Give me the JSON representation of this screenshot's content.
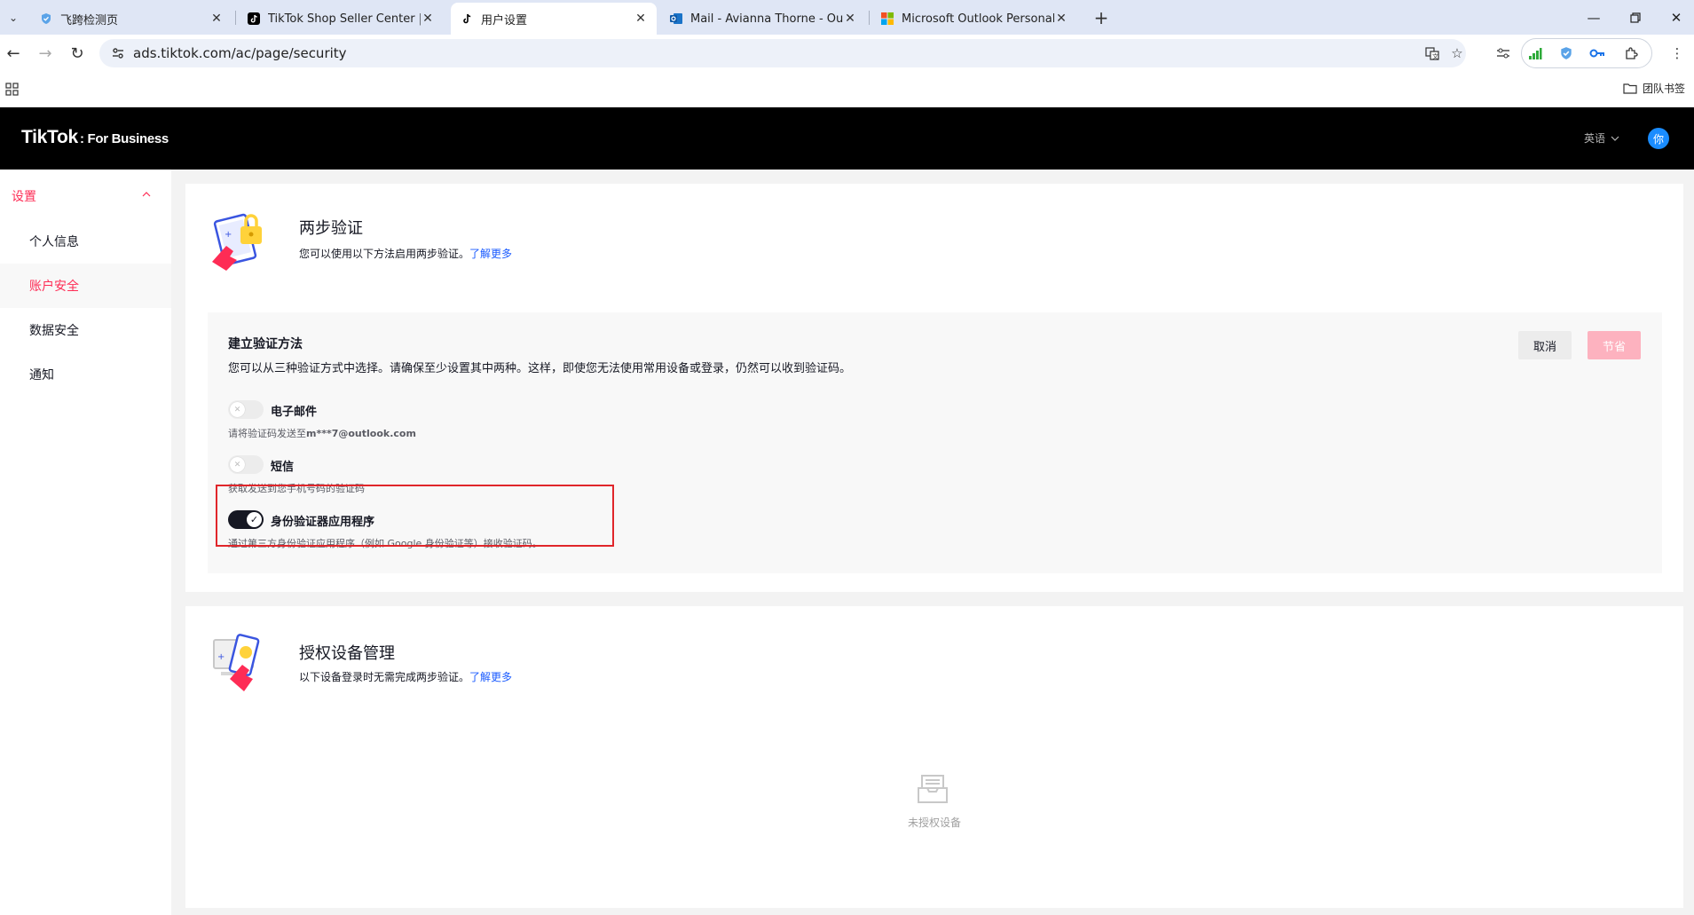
{
  "browser": {
    "tabs": [
      {
        "title": "飞跨检测页",
        "favicon": "shield-icon",
        "active": false
      },
      {
        "title": "TikTok Shop Seller Center | Ti",
        "favicon": "tiktok-icon",
        "active": false
      },
      {
        "title": "用户设置",
        "favicon": "tiktok-icon",
        "active": true
      },
      {
        "title": "Mail - Avianna Thorne - Outlo",
        "favicon": "outlook-icon",
        "active": false
      },
      {
        "title": "Microsoft Outlook Personal E",
        "favicon": "microsoft-icon",
        "active": false
      }
    ],
    "url": "ads.tiktok.com/ac/page/security",
    "bookmark_folder": "团队书签"
  },
  "header": {
    "logo_main": "TikTok",
    "logo_sub": ": For Business",
    "language": "英语",
    "avatar": "你"
  },
  "sidebar": {
    "heading": "设置",
    "items": [
      {
        "label": "个人信息",
        "active": false
      },
      {
        "label": "账户安全",
        "active": true
      },
      {
        "label": "数据安全",
        "active": false
      },
      {
        "label": "通知",
        "active": false
      }
    ]
  },
  "two_step": {
    "title": "两步验证",
    "subtitle": "您可以使用以下方法启用两步验证。",
    "learn_more": "了解更多",
    "panel": {
      "title": "建立验证方法",
      "description": "您可以从三种验证方式中选择。请确保至少设置其中两种。这样，即使您无法使用常用设备或登录，仍然可以收到验证码。",
      "cancel": "取消",
      "save": "节省",
      "options": [
        {
          "label": "电子邮件",
          "desc_prefix": "请将验证码发送至",
          "desc_bold": "m***7@outlook.com",
          "enabled": false
        },
        {
          "label": "短信",
          "desc_prefix": "获取发送到您手机号码的验证码",
          "desc_bold": "",
          "enabled": false
        },
        {
          "label": "身份验证器应用程序",
          "desc_prefix": "通过第三方身份验证应用程序（例如 Google 身份验证等）接收验证码。",
          "desc_bold": "",
          "enabled": true
        }
      ]
    }
  },
  "devices": {
    "title": "授权设备管理",
    "subtitle": "以下设备登录时无需完成两步验证。",
    "learn_more": "了解更多",
    "empty_text": "未授权设备"
  },
  "colors": {
    "accent": "#fe2c55",
    "link": "#1a5bff",
    "highlight": "#e0262b"
  }
}
